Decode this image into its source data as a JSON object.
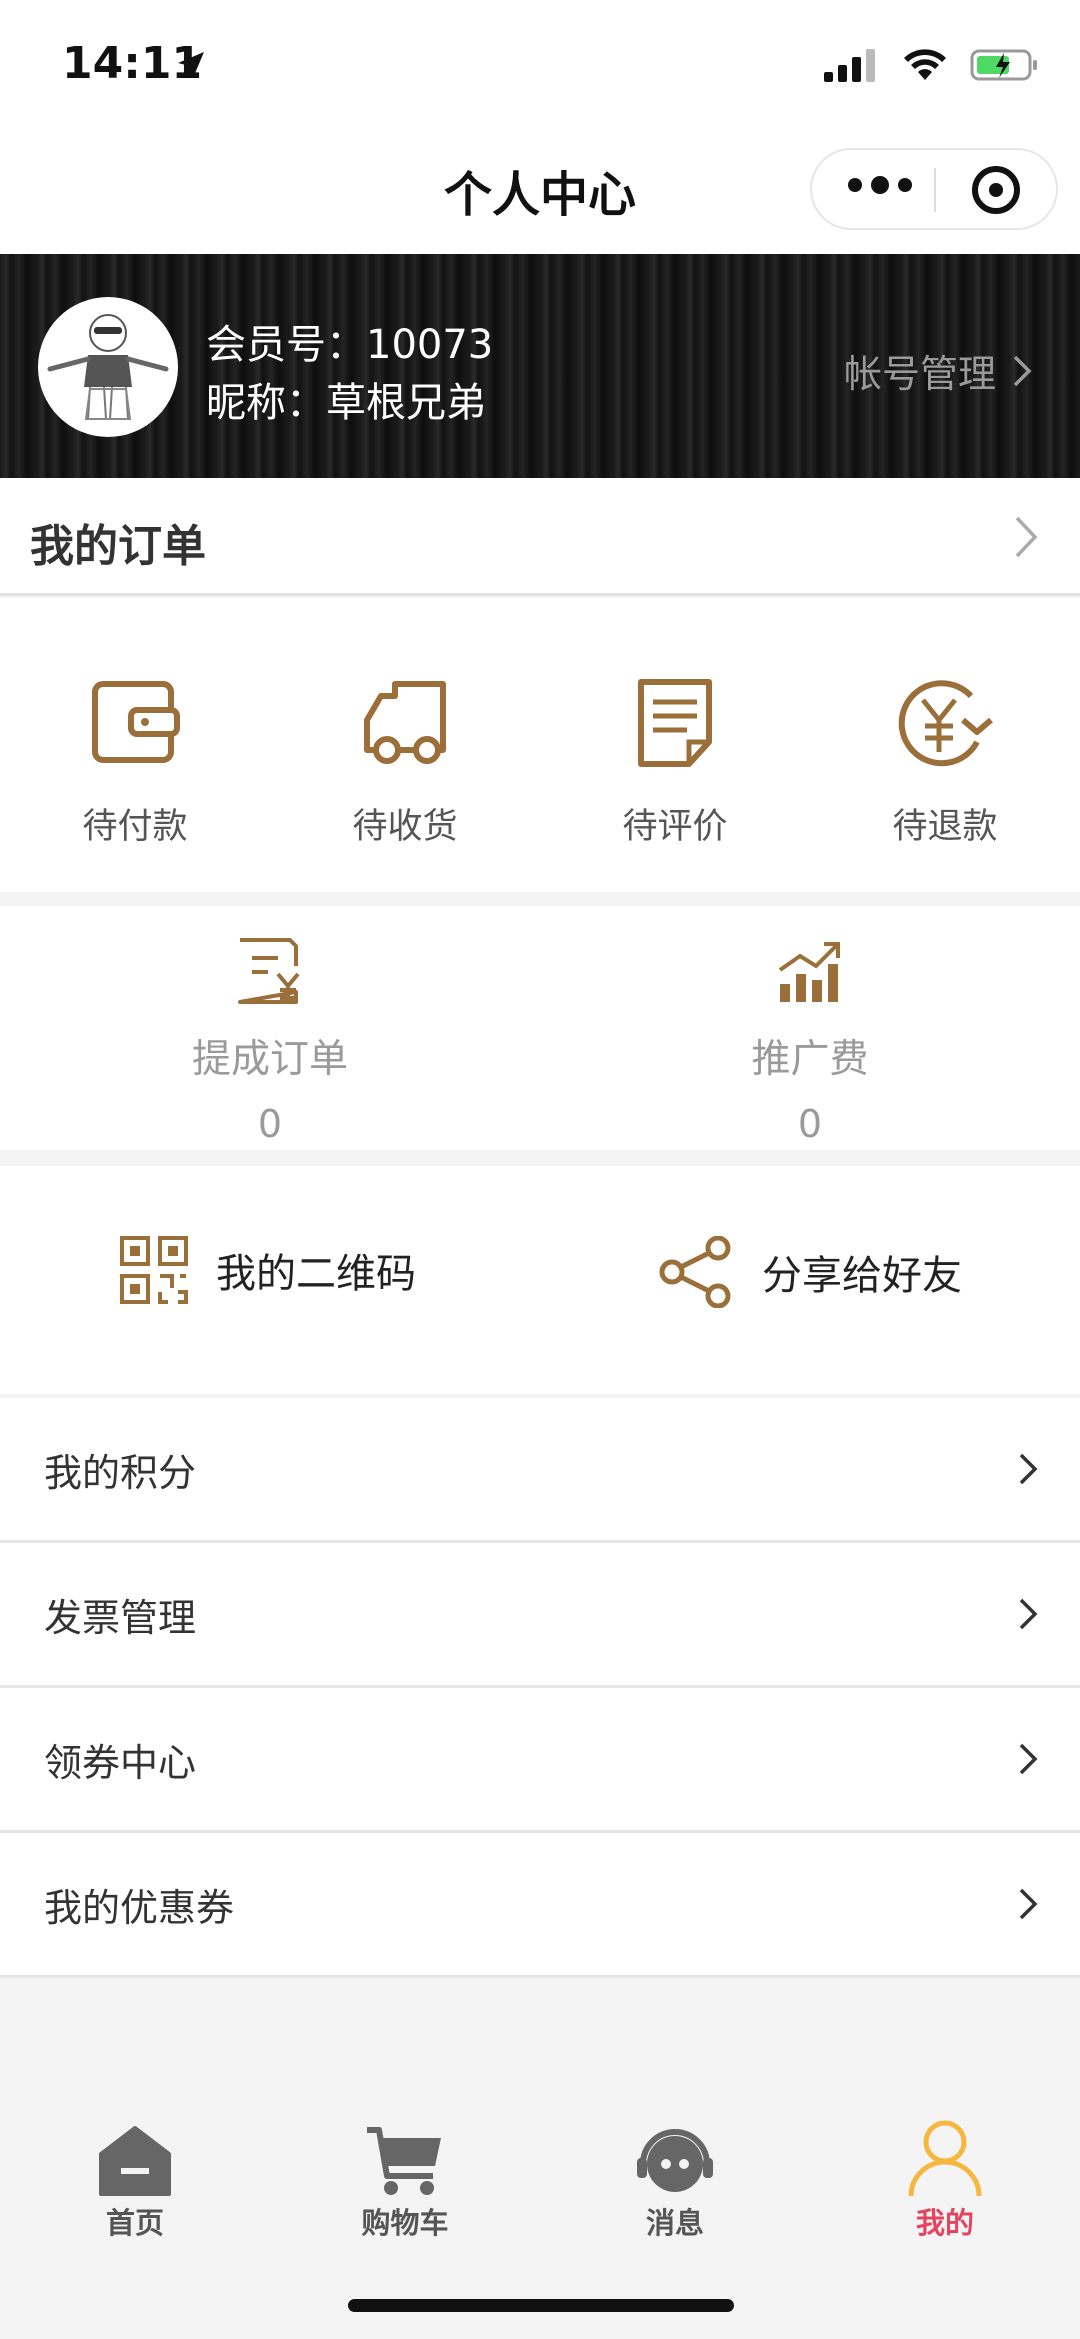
{
  "status_bar": {
    "time": "14:11"
  },
  "nav": {
    "title": "个人中心"
  },
  "profile": {
    "member_no": "会员号：10073",
    "nickname": "昵称：草根兄弟",
    "account_link": "帐号管理"
  },
  "orders": {
    "title": "我的订单",
    "items": [
      {
        "label": "待付款",
        "icon": "wallet-icon"
      },
      {
        "label": "待收货",
        "icon": "truck-icon"
      },
      {
        "label": "待评价",
        "icon": "document-icon"
      },
      {
        "label": "待退款",
        "icon": "refund-yen-icon"
      }
    ]
  },
  "commission": {
    "items": [
      {
        "label": "提成订单",
        "value": "0",
        "icon": "yen-bill-icon"
      },
      {
        "label": "推广费",
        "value": "0",
        "icon": "growth-chart-icon"
      }
    ]
  },
  "share": {
    "qr_label": "我的二维码",
    "share_label": "分享给好友"
  },
  "menu": {
    "items": [
      {
        "label": "我的积分"
      },
      {
        "label": "发票管理"
      },
      {
        "label": "领券中心"
      },
      {
        "label": "我的优惠券"
      }
    ]
  },
  "tabbar": {
    "items": [
      {
        "label": "首页",
        "icon": "home-icon"
      },
      {
        "label": "购物车",
        "icon": "cart-icon"
      },
      {
        "label": "消息",
        "icon": "message-icon"
      },
      {
        "label": "我的",
        "icon": "user-icon",
        "active": true
      }
    ]
  },
  "colors": {
    "accent": "#9a6f3a",
    "active_tab": "#e5445f",
    "header_bg": "#1a1a1a"
  }
}
